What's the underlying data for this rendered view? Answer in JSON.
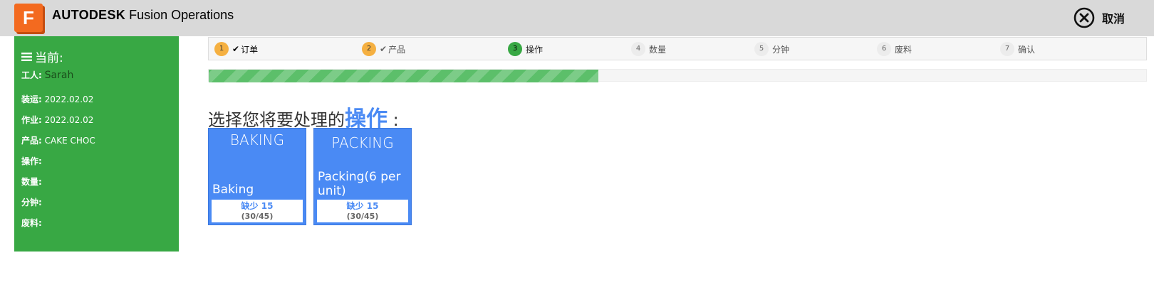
{
  "header": {
    "logo_letter": "F",
    "brand_bold": "AUTODESK",
    "brand_rest": " Fusion Operations",
    "cancel_label": "取消",
    "logo_color": "#f36a1f"
  },
  "sidebar": {
    "title": "当前:",
    "worker_label": "工人:",
    "worker_value": "Sarah",
    "rows": [
      {
        "label": "装运:",
        "value": "2022.02.02"
      },
      {
        "label": "作业:",
        "value": "2022.02.02"
      },
      {
        "label": "产品:",
        "value": "CAKE CHOC"
      },
      {
        "label": "操作:",
        "value": ""
      },
      {
        "label": "数量:",
        "value": ""
      },
      {
        "label": "分钟:",
        "value": ""
      },
      {
        "label": "废料:",
        "value": ""
      }
    ],
    "color": "#38a844"
  },
  "steps": [
    {
      "num": "1",
      "label": "订单",
      "state": "done"
    },
    {
      "num": "2",
      "label": "产品",
      "state": "done"
    },
    {
      "num": "3",
      "label": "操作",
      "state": "active"
    },
    {
      "num": "4",
      "label": "数量",
      "state": "todo"
    },
    {
      "num": "5",
      "label": "分钟",
      "state": "todo"
    },
    {
      "num": "6",
      "label": "废料",
      "state": "todo"
    },
    {
      "num": "7",
      "label": "确认",
      "state": "todo"
    }
  ],
  "progress": {
    "fraction": 0.416
  },
  "prompt": {
    "before": "选择您将要处理的",
    "highlight": "操作",
    "after": " :"
  },
  "operations": [
    {
      "code": "BAKING",
      "name": "Baking",
      "short": "缺少 15",
      "fraction": "(30/45)"
    },
    {
      "code": "PACKING",
      "name": "Packing(6 per unit)",
      "short": "缺少 15",
      "fraction": "(30/45)"
    }
  ],
  "colors": {
    "accent": "#4a8af4",
    "step_done": "#f5b041",
    "step_active": "#38a844"
  }
}
